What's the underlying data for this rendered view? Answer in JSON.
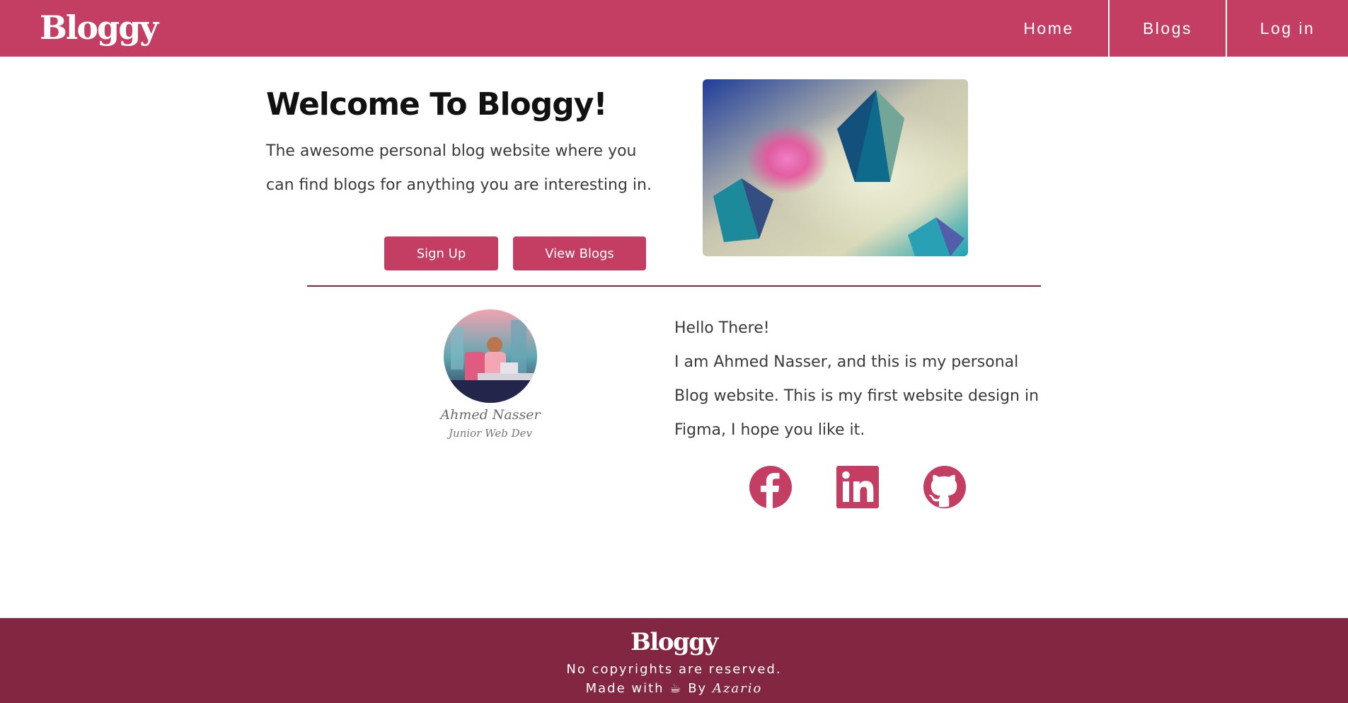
{
  "header": {
    "logo": "Bloggy",
    "nav": [
      {
        "label": "Home"
      },
      {
        "label": "Blogs"
      },
      {
        "label": "Log in"
      }
    ]
  },
  "hero": {
    "title": "Welcome To Bloggy!",
    "description": "The awesome personal blog website where you can find blogs for anything you are interesting in.",
    "buttons": {
      "signup": "Sign Up",
      "view_blogs": "View Blogs"
    }
  },
  "profile": {
    "name": "Ahmed Nasser",
    "role": "Junior Web Dev"
  },
  "about": {
    "greeting": "Hello There!",
    "text": "I am Ahmed Nasser, and this is my personal Blog website. This is my first website design in Figma, I hope you like it."
  },
  "social": [
    "facebook-icon",
    "linkedin-icon",
    "github-icon"
  ],
  "footer": {
    "logo": "Bloggy",
    "line1": "No copyrights are reserved.",
    "made_with": "Made with",
    "coffee": "☕",
    "by": "By",
    "author": "Azario"
  },
  "colors": {
    "primary": "#c43d62",
    "footer": "#822641",
    "divider": "#8a2444"
  }
}
